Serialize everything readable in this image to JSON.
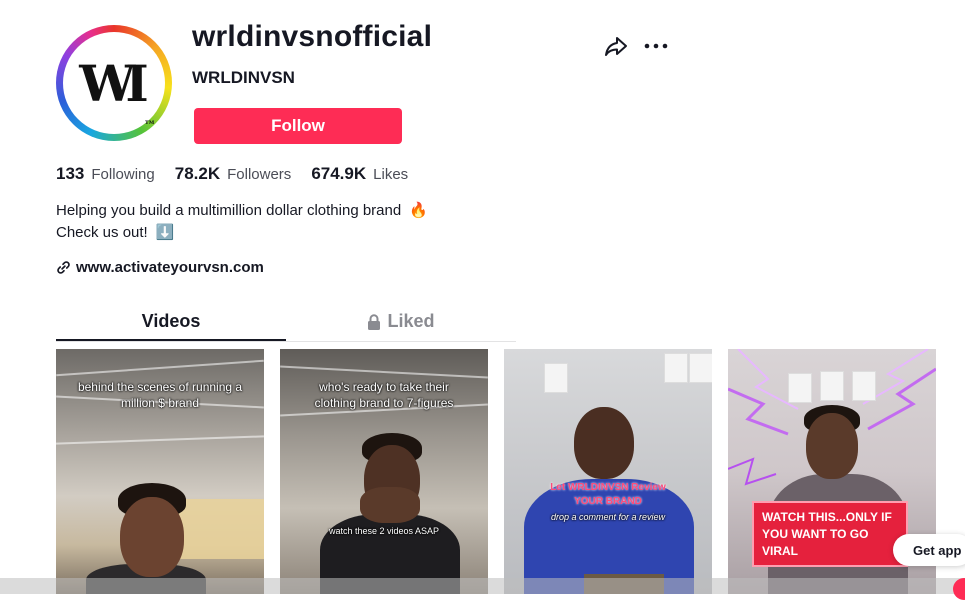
{
  "profile": {
    "username": "wrldinvsnofficial",
    "nickname": "WRLDINVSN",
    "follow_label": "Follow",
    "avatar_letters": "WI",
    "avatar_tm": "TM"
  },
  "header_actions": {
    "share_icon": "share-arrow-icon",
    "more_icon": "ellipsis-icon"
  },
  "stats": [
    {
      "value": "133",
      "label": "Following"
    },
    {
      "value": "78.2K",
      "label": "Followers"
    },
    {
      "value": "674.9K",
      "label": "Likes"
    }
  ],
  "bio": {
    "line1": "Helping you build a multimillion dollar clothing brand",
    "line1_emoji": "🔥",
    "line2": "Check us out!",
    "line2_emoji": "⬇️"
  },
  "link": {
    "url_text": "www.activateyourvsn.com",
    "icon": "link-icon"
  },
  "tabs": [
    {
      "label": "Videos",
      "active": true
    },
    {
      "label": "Liked",
      "icon": "lock-icon"
    }
  ],
  "videos": [
    {
      "caption": "behind the scenes of running a million $ brand"
    },
    {
      "caption": "who's ready to take their clothing brand to 7-figures",
      "subcaption": "watch these 2 videos ASAP"
    },
    {
      "caption_line1": "Let WRLDINVSN Review",
      "caption_line2": "YOUR BRAND",
      "subcaption": "drop a comment for a review"
    },
    {
      "banner": "WATCH THIS...ONLY IF YOU WANT TO GO VIRAL"
    }
  ],
  "get_app_label": "Get app",
  "colors": {
    "accent": "#fe2c55",
    "text": "#161823",
    "muted": "#4b4d57"
  }
}
